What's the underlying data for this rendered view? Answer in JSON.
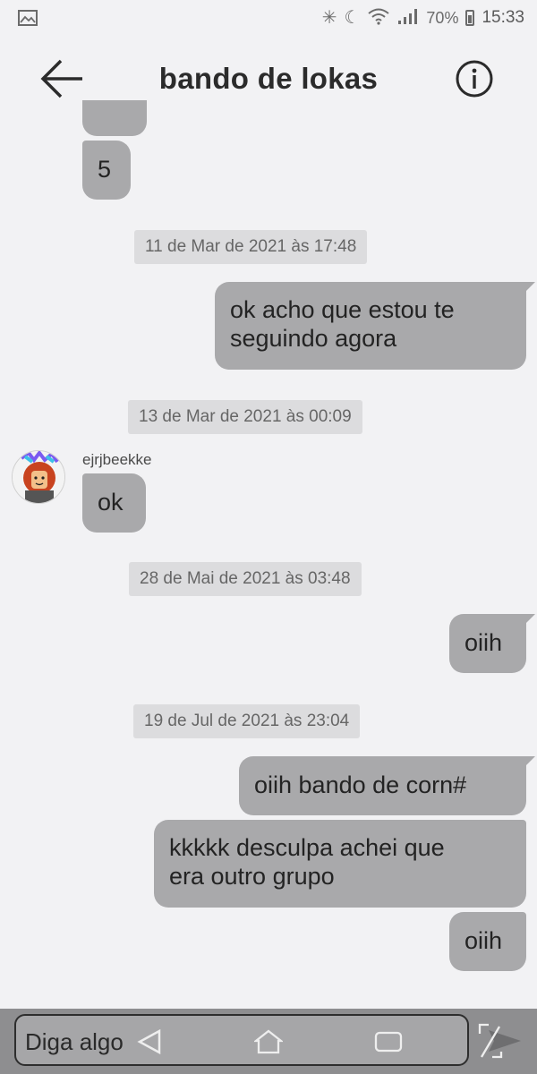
{
  "status_bar": {
    "battery": "70%",
    "time": "15:33"
  },
  "header": {
    "title": "bando de lokas"
  },
  "messages": {
    "prev_count": "5",
    "date1": "11 de Mar de 2021 às 17:48",
    "msg1_line1": "ok acho que estou te",
    "msg1_line2": "seguindo agora",
    "date2": "13 de Mar de 2021 às 00:09",
    "sender_name": "ejrjbeekke",
    "msg2": "ok",
    "date3": "28 de Mai de 2021 às 03:48",
    "msg3": "oiih",
    "date4": "19 de Jul de 2021 às 23:04",
    "msg4": "oiih bando de corn#",
    "msg5_line1": "kkkkk desculpa achei que",
    "msg5_line2": "era outro grupo",
    "msg6": "oiih"
  },
  "composer": {
    "placeholder": "Diga algo"
  },
  "colors": {
    "bubble": "#a9a9ab",
    "background": "#f2f2f4",
    "date_chip": "#dcdcde",
    "input_bar": "#8e8e90"
  }
}
